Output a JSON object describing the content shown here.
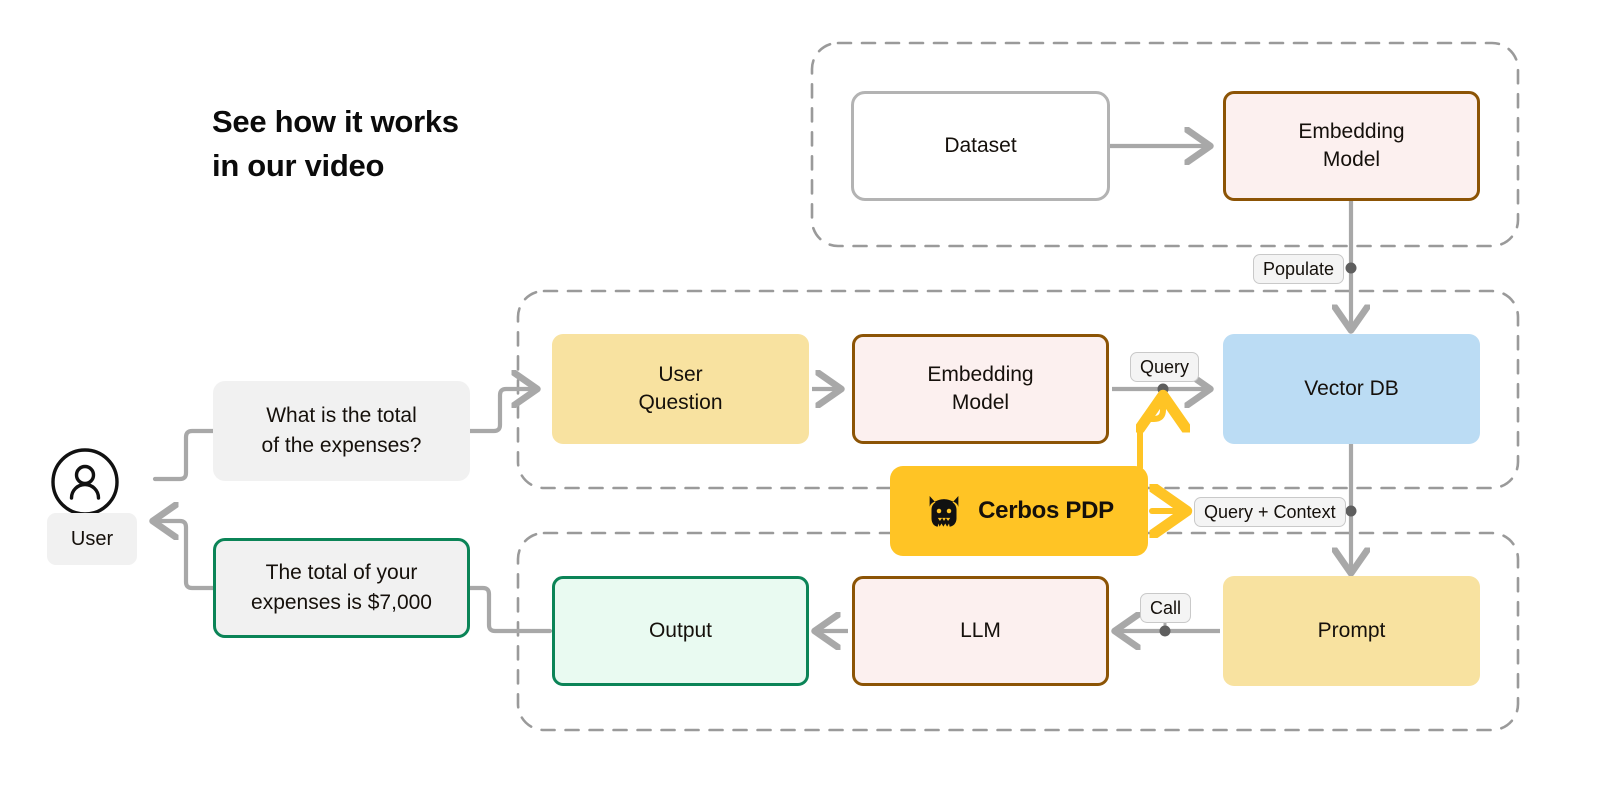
{
  "headline": {
    "line1": "See how it works",
    "line2": "in our video"
  },
  "colors": {
    "brand_yellow": "#ffc425",
    "box_yellow": "#f8e2a0",
    "vector_blue": "#bbdcf4",
    "embedding_pink": "#fcf0ef",
    "embedding_border": "#8c5405",
    "output_green_fill": "#e9faf1",
    "output_green_border": "#0b8457",
    "bubble_gray": "#f1f1f1",
    "connector_gray": "#a8a8a8",
    "dashed_gray": "#9a9a9a"
  },
  "user": {
    "label": "User",
    "avatar_icon": "user-circle-icon"
  },
  "bubbles": {
    "question": "What is the total\nof the expenses?",
    "answer": "The total of your\nexpenses is $7,000"
  },
  "groups": {
    "ingestion": {
      "name": "ingestion-pipeline"
    },
    "retrieval": {
      "name": "retrieval-pipeline"
    },
    "generation": {
      "name": "generation-pipeline"
    }
  },
  "nodes": {
    "dataset": "Dataset",
    "embedding_model_top": "Embedding\nModel",
    "vector_db": "Vector DB",
    "user_question": "User\nQuestion",
    "embedding_model_mid": "Embedding\nModel",
    "cerbos_pdp": "Cerbos PDP",
    "prompt": "Prompt",
    "llm": "LLM",
    "output": "Output"
  },
  "edge_labels": {
    "populate": "Populate",
    "query": "Query",
    "query_context": "Query + Context",
    "call": "Call"
  }
}
